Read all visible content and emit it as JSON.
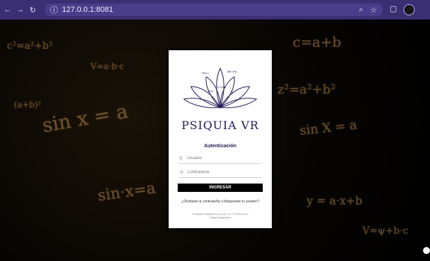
{
  "browser": {
    "url": "127.0.0.1:8081"
  },
  "login": {
    "brand": "PSIQUIA VR",
    "title": "Autenticación",
    "username_placeholder": "Usuario",
    "password_placeholder": "Contraseña",
    "submit_label": "INGRESAR",
    "forgot_link": "¿Olvidaste la contraseña o bloqueaste tu usuario?",
    "footer_line1": "© Nexion Solutions S.A. de C.V. © 2024 3.6.4",
    "footer_line2": "Talent Acquisition"
  },
  "background": {
    "formulas": [
      "sin x = a",
      "c²=a²+b²",
      "y = a·x+b",
      "V=a·b·c",
      "sin·x=a",
      "(a+b)²",
      "z²=a²+b²",
      "c=a+b",
      "sin X = a",
      "V=ψ+b·c"
    ]
  }
}
